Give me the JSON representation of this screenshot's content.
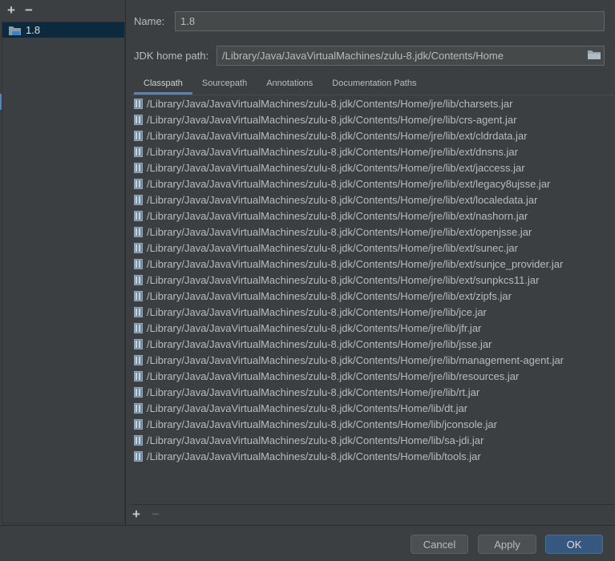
{
  "sdk_list": {
    "add_label": "+",
    "remove_label": "−",
    "items": [
      {
        "label": "1.8",
        "icon": "jdk-folder-icon"
      }
    ]
  },
  "form": {
    "name_label": "Name:",
    "name_value": "1.8",
    "home_label": "JDK home path:",
    "home_value": "/Library/Java/JavaVirtualMachines/zulu-8.jdk/Contents/Home",
    "browse_icon": "folder-icon"
  },
  "tabs": [
    {
      "label": "Classpath",
      "active": true
    },
    {
      "label": "Sourcepath",
      "active": false
    },
    {
      "label": "Annotations",
      "active": false
    },
    {
      "label": "Documentation Paths",
      "active": false
    }
  ],
  "classpath": [
    "/Library/Java/JavaVirtualMachines/zulu-8.jdk/Contents/Home/jre/lib/charsets.jar",
    "/Library/Java/JavaVirtualMachines/zulu-8.jdk/Contents/Home/jre/lib/crs-agent.jar",
    "/Library/Java/JavaVirtualMachines/zulu-8.jdk/Contents/Home/jre/lib/ext/cldrdata.jar",
    "/Library/Java/JavaVirtualMachines/zulu-8.jdk/Contents/Home/jre/lib/ext/dnsns.jar",
    "/Library/Java/JavaVirtualMachines/zulu-8.jdk/Contents/Home/jre/lib/ext/jaccess.jar",
    "/Library/Java/JavaVirtualMachines/zulu-8.jdk/Contents/Home/jre/lib/ext/legacy8ujsse.jar",
    "/Library/Java/JavaVirtualMachines/zulu-8.jdk/Contents/Home/jre/lib/ext/localedata.jar",
    "/Library/Java/JavaVirtualMachines/zulu-8.jdk/Contents/Home/jre/lib/ext/nashorn.jar",
    "/Library/Java/JavaVirtualMachines/zulu-8.jdk/Contents/Home/jre/lib/ext/openjsse.jar",
    "/Library/Java/JavaVirtualMachines/zulu-8.jdk/Contents/Home/jre/lib/ext/sunec.jar",
    "/Library/Java/JavaVirtualMachines/zulu-8.jdk/Contents/Home/jre/lib/ext/sunjce_provider.jar",
    "/Library/Java/JavaVirtualMachines/zulu-8.jdk/Contents/Home/jre/lib/ext/sunpkcs11.jar",
    "/Library/Java/JavaVirtualMachines/zulu-8.jdk/Contents/Home/jre/lib/ext/zipfs.jar",
    "/Library/Java/JavaVirtualMachines/zulu-8.jdk/Contents/Home/jre/lib/jce.jar",
    "/Library/Java/JavaVirtualMachines/zulu-8.jdk/Contents/Home/jre/lib/jfr.jar",
    "/Library/Java/JavaVirtualMachines/zulu-8.jdk/Contents/Home/jre/lib/jsse.jar",
    "/Library/Java/JavaVirtualMachines/zulu-8.jdk/Contents/Home/jre/lib/management-agent.jar",
    "/Library/Java/JavaVirtualMachines/zulu-8.jdk/Contents/Home/jre/lib/resources.jar",
    "/Library/Java/JavaVirtualMachines/zulu-8.jdk/Contents/Home/jre/lib/rt.jar",
    "/Library/Java/JavaVirtualMachines/zulu-8.jdk/Contents/Home/lib/dt.jar",
    "/Library/Java/JavaVirtualMachines/zulu-8.jdk/Contents/Home/lib/jconsole.jar",
    "/Library/Java/JavaVirtualMachines/zulu-8.jdk/Contents/Home/lib/sa-jdi.jar",
    "/Library/Java/JavaVirtualMachines/zulu-8.jdk/Contents/Home/lib/tools.jar"
  ],
  "list_toolbar": {
    "add_label": "+",
    "remove_label": "−"
  },
  "buttons": {
    "cancel": "Cancel",
    "apply": "Apply",
    "ok": "OK"
  },
  "colors": {
    "accent": "#4a88c7",
    "selection": "#0d293e",
    "primary_button": "#365880"
  }
}
